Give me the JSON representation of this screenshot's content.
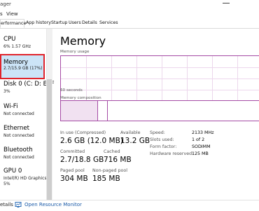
{
  "window": {
    "title": "ager"
  },
  "menu": {
    "items": [
      "s",
      "View"
    ]
  },
  "tabs": [
    "erformance",
    "App history",
    "Startup",
    "Users",
    "Details",
    "Services"
  ],
  "sidebar": {
    "items": [
      {
        "name": "CPU",
        "sub": "6%  1.57 GHz"
      },
      {
        "name": "Memory",
        "sub": "2.7/15.9 GB (17%)"
      },
      {
        "name": "Disk 0 (C: D: E: F",
        "sub": "3%"
      },
      {
        "name": "Wi-Fi",
        "sub": "Not connected"
      },
      {
        "name": "Ethernet",
        "sub": "Not connected"
      },
      {
        "name": "Bluetooth",
        "sub": "Not connected"
      },
      {
        "name": "GPU 0",
        "sub": "Intel(R) HD Graphics",
        "sub2": "5%"
      }
    ]
  },
  "main": {
    "title": "Memory",
    "usage_label": "Memory usage",
    "seconds_label": "60 seconds",
    "composition_label": "Memory composition",
    "stats": {
      "in_use_label": "In use (Compressed)",
      "in_use_value": "2.6 GB (12.0 MB)",
      "available_label": "Available",
      "available_value": "13.2 GB",
      "committed_label": "Committed",
      "committed_value": "2.7/18.8 GB",
      "cached_label": "Cached",
      "cached_value": "716 MB",
      "paged_label": "Paged pool",
      "paged_value": "304 MB",
      "nonpaged_label": "Non-paged pool",
      "nonpaged_value": "185 MB"
    },
    "specs": {
      "speed_label": "Speed:",
      "speed_value": "2133 MHz",
      "slots_label": "Slots used:",
      "slots_value": "1 of 2",
      "form_label": "Form factor:",
      "form_value": "SODIMM",
      "hw_label": "Hardware reserved:",
      "hw_value": "125 MB"
    }
  },
  "footer": {
    "details_label": "etails",
    "link_label": "Open Resource Monitor"
  },
  "colors": {
    "accent": "#a54ca5",
    "selection_border": "#e0242b",
    "selection_bg": "#cce4f7",
    "link": "#1a5aa8"
  }
}
